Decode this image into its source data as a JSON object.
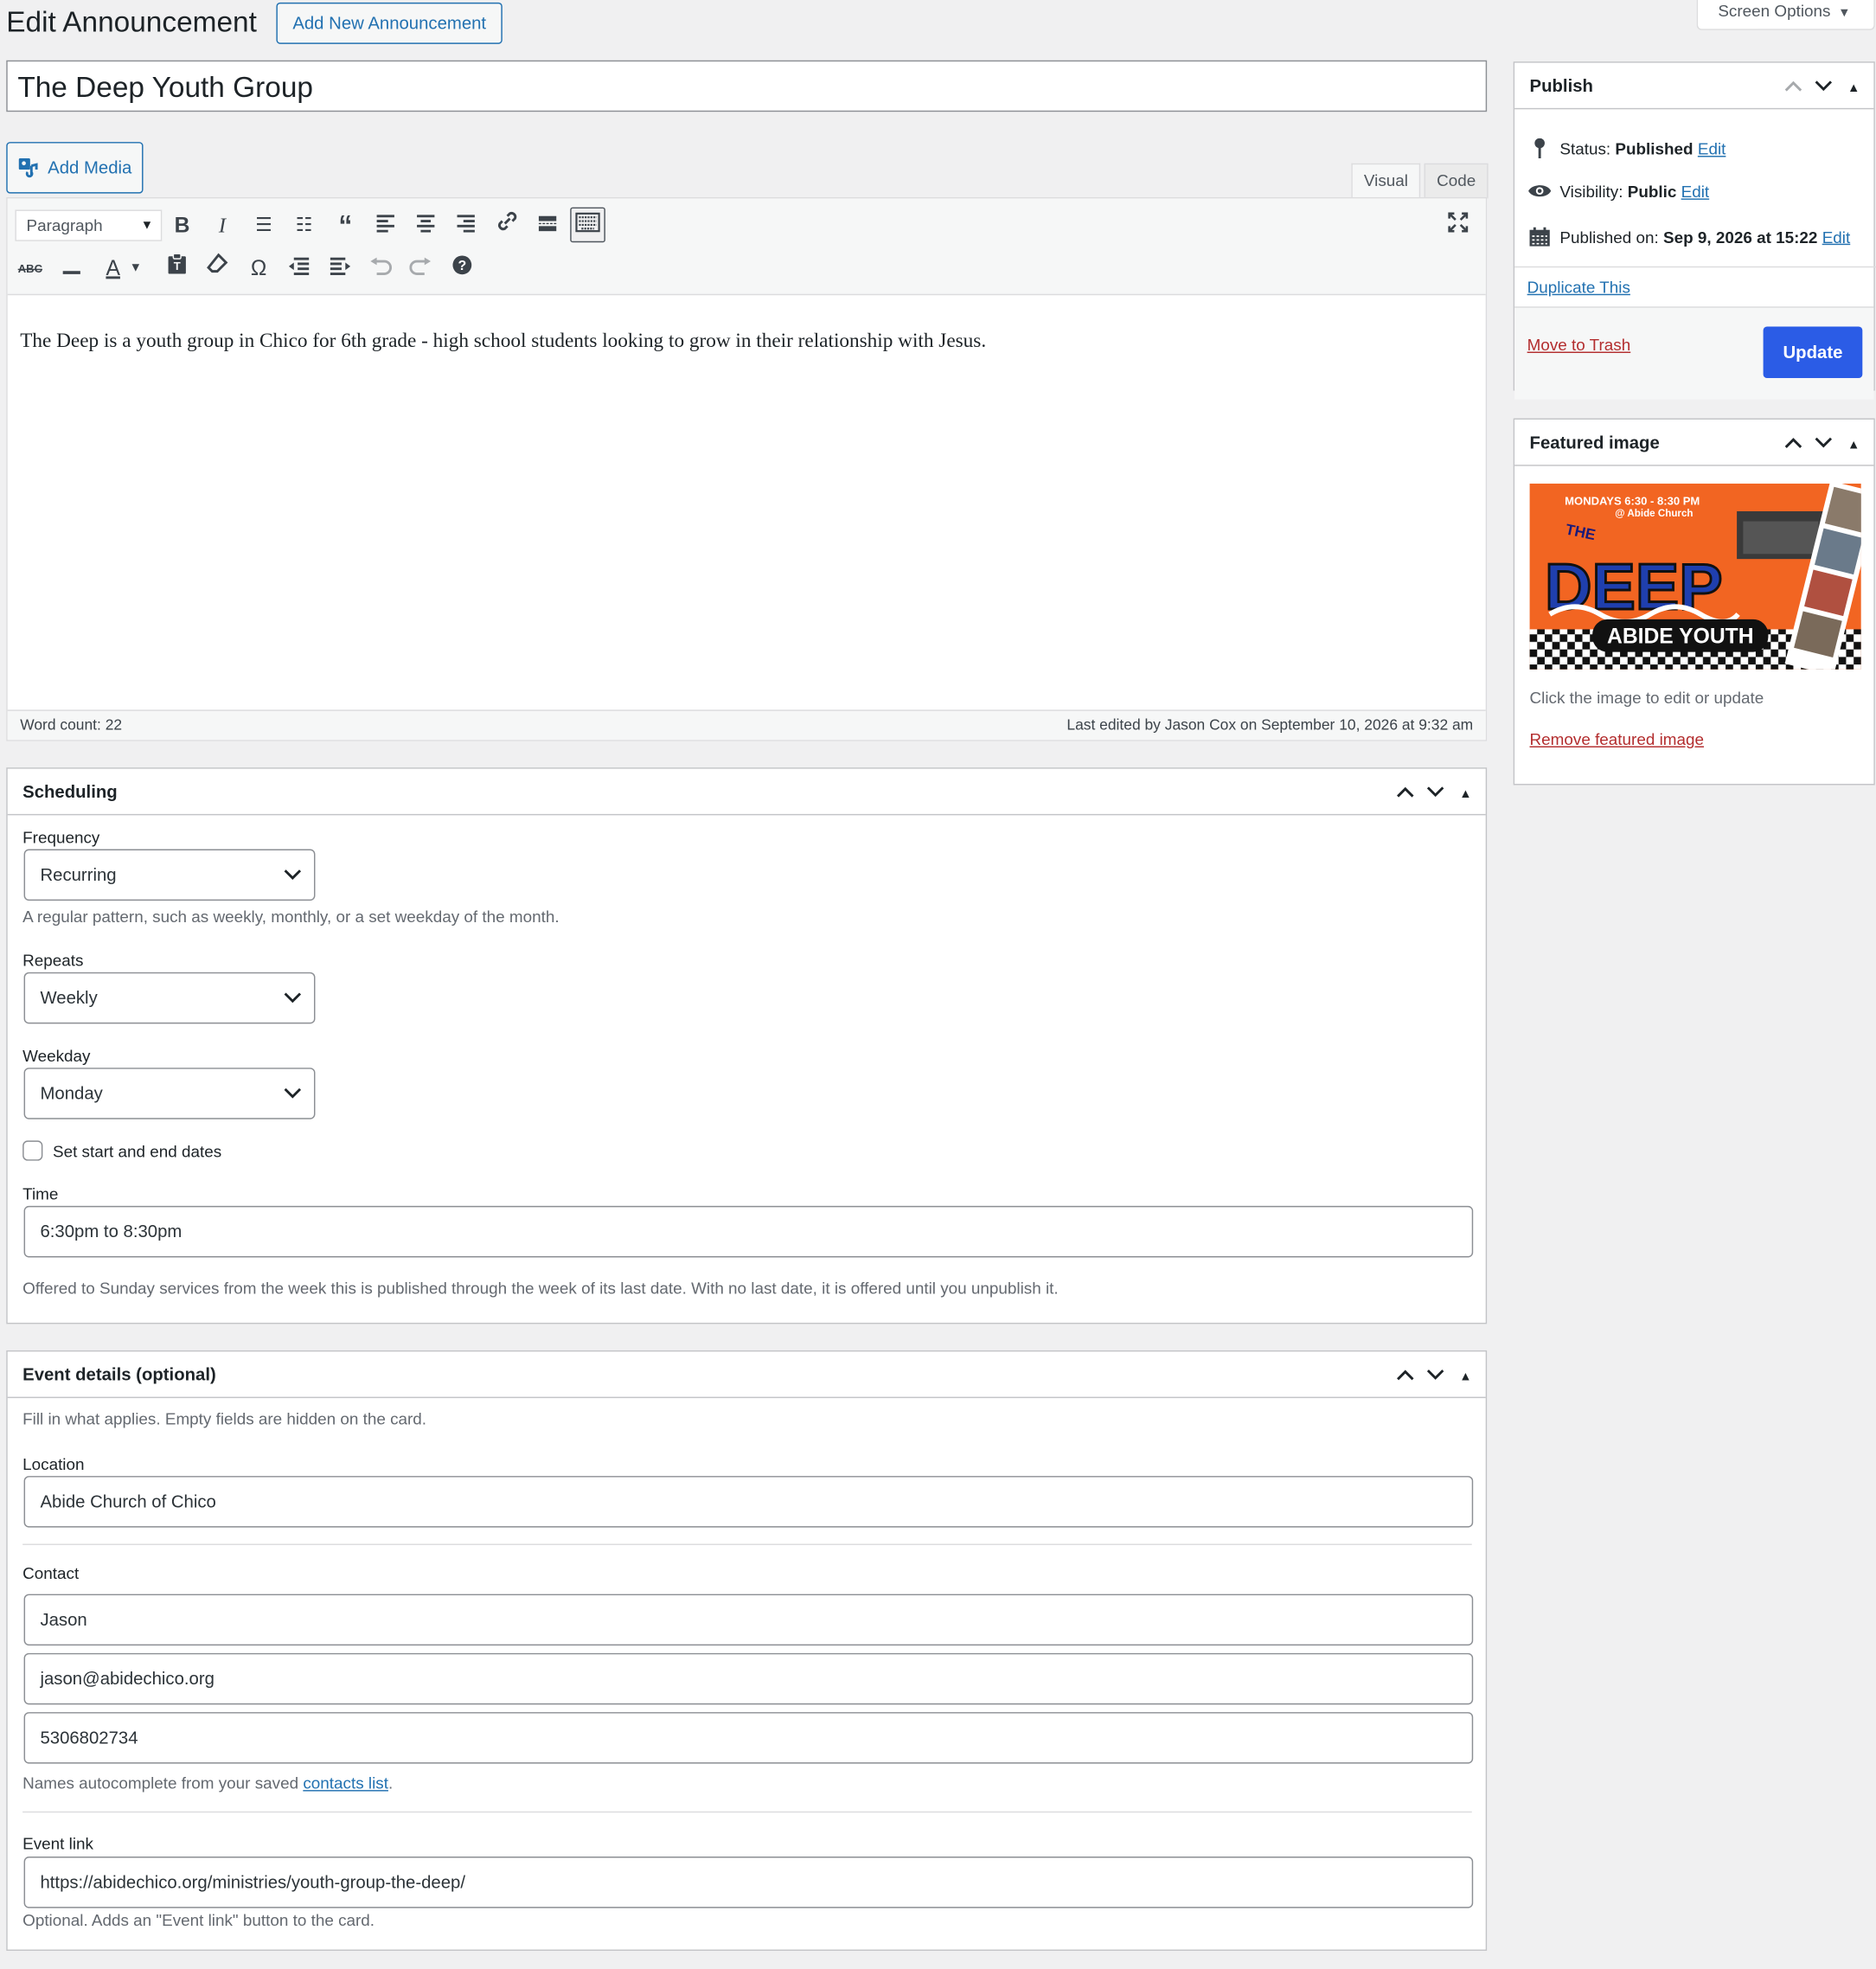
{
  "header": {
    "page_title": "Edit Announcement",
    "add_new_label": "Add New Announcement",
    "screen_options_label": "Screen Options"
  },
  "title_value": "The Deep Youth Group",
  "editor": {
    "add_media_label": "Add Media",
    "tab_visual": "Visual",
    "tab_code": "Code",
    "format_select": "Paragraph",
    "content": "The Deep is a youth group in Chico for 6th grade - high school students looking to grow in their relationship with Jesus.",
    "word_count": "Word count: 22",
    "last_edited": "Last edited by Jason Cox on September 10, 2026 at 9:32 am",
    "toolbar_icons": [
      "bold-icon",
      "italic-icon",
      "bullet-list-icon",
      "numbered-list-icon",
      "blockquote-icon",
      "align-left-icon",
      "align-center-icon",
      "align-right-icon",
      "link-icon",
      "read-more-icon",
      "toolbar-toggle-icon",
      "fullscreen-icon",
      "strikethrough-icon",
      "horizontal-line-icon",
      "text-color-icon",
      "paste-text-icon",
      "clear-formatting-icon",
      "special-character-icon",
      "outdent-icon",
      "indent-icon",
      "undo-icon",
      "redo-icon",
      "help-icon"
    ]
  },
  "scheduling": {
    "title": "Scheduling",
    "frequency_label": "Frequency",
    "frequency_value": "Recurring",
    "frequency_help": "A regular pattern, such as weekly, monthly, or a set weekday of the month.",
    "repeats_label": "Repeats",
    "repeats_value": "Weekly",
    "weekday_label": "Weekday",
    "weekday_value": "Monday",
    "dates_checkbox_label": "Set start and end dates",
    "dates_checked": false,
    "time_label": "Time",
    "time_value": "6:30pm to 8:30pm",
    "time_help": "Offered to Sunday services from the week this is published through the week of its last date. With no last date, it is offered until you unpublish it."
  },
  "event_details": {
    "title": "Event details (optional)",
    "intro": "Fill in what applies. Empty fields are hidden on the card.",
    "location_label": "Location",
    "location_value": "Abide Church of Chico",
    "contact_label": "Contact",
    "contact_name": "Jason",
    "contact_email": "jason@abidechico.org",
    "contact_phone": "5306802734",
    "contact_help_prefix": "Names autocomplete from your saved ",
    "contact_help_link": "contacts list",
    "contact_help_suffix": ".",
    "link_label": "Event link",
    "link_value": "https://abidechico.org/ministries/youth-group-the-deep/",
    "link_help": "Optional. Adds an \"Event link\" button to the card."
  },
  "publish": {
    "title": "Publish",
    "status_label": "Status: ",
    "status_value": "Published",
    "visibility_label": "Visibility: ",
    "visibility_value": "Public",
    "published_label": "Published on: ",
    "published_value": "Sep 9, 2026 at 15:22",
    "edit_link": "Edit",
    "duplicate_label": "Duplicate This",
    "trash_label": "Move to Trash",
    "update_label": "Update"
  },
  "featured_image": {
    "title": "Featured image",
    "img_line1": "MONDAYS 6:30 - 8:30 PM",
    "img_line2": "@ Abide Church",
    "img_the": "THE",
    "img_deep": "DEEP",
    "img_youth": "ABIDE YOUTH",
    "hint": "Click the image to edit or update",
    "remove_label": "Remove featured image"
  },
  "colors": {
    "accent": "#2271b1",
    "update_button": "#2b5ce6",
    "trash": "#b32d2e",
    "feature_orange": "#f26522"
  }
}
